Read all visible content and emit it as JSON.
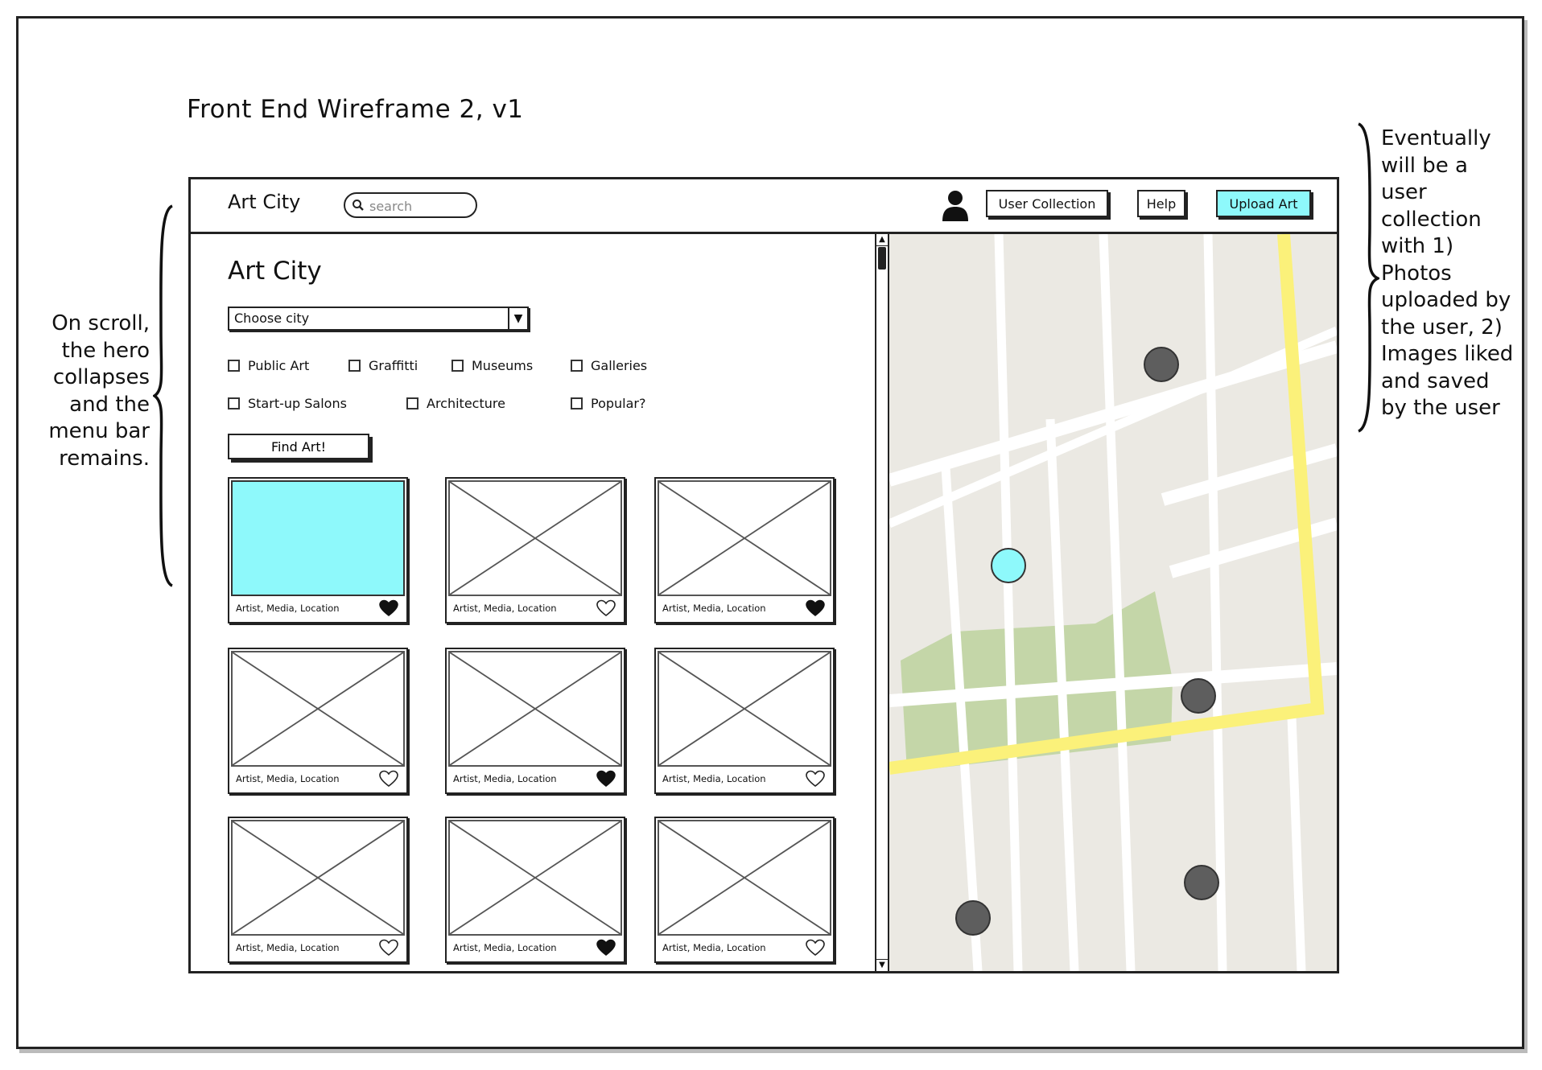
{
  "wireframe_title": "Front End Wireframe 2, v1",
  "notes": {
    "left": "On scroll,\nthe hero\ncollapses\nand the\nmenu bar\nremains.",
    "right": "Eventually\nwill be a\nuser\ncollection\nwith 1)\nPhotos\nuploaded by\nthe user, 2)\nImages liked\nand saved\nby the user"
  },
  "navbar": {
    "brand": "Art City",
    "search_placeholder": "search",
    "buttons": {
      "user_collection": "User Collection",
      "help": "Help",
      "upload_art": "Upload Art"
    }
  },
  "hero": {
    "title": "Art City",
    "city_select_value": "Choose city",
    "filters": [
      "Public Art",
      "Graffitti",
      "Museums",
      "Galleries",
      "Start-up Salons",
      "Architecture",
      "Popular?"
    ],
    "find_button": "Find Art!"
  },
  "cards": [
    {
      "caption": "Artist, Media, Location",
      "liked": true,
      "placeholder": "highlighted"
    },
    {
      "caption": "Artist, Media, Location",
      "liked": false,
      "placeholder": "image"
    },
    {
      "caption": "Artist, Media, Location",
      "liked": true,
      "placeholder": "image"
    },
    {
      "caption": "Artist, Media, Location",
      "liked": false,
      "placeholder": "image"
    },
    {
      "caption": "Artist, Media, Location",
      "liked": true,
      "placeholder": "image"
    },
    {
      "caption": "Artist, Media, Location",
      "liked": false,
      "placeholder": "image"
    },
    {
      "caption": "Artist, Media, Location",
      "liked": false,
      "placeholder": "image"
    },
    {
      "caption": "Artist, Media, Location",
      "liked": true,
      "placeholder": "image"
    },
    {
      "caption": "Artist, Media, Location",
      "liked": false,
      "placeholder": "image"
    }
  ],
  "colors": {
    "accent": "#8ef9fb",
    "map_background": "#ebe9e3",
    "map_road": "#ffffff",
    "map_highway": "#fbf17a",
    "map_park": "#c4d6a8",
    "marker": "#5e5e5e",
    "marker_selected": "#8ef9fb"
  },
  "icons": {
    "search": "search-icon",
    "user": "user-icon",
    "heart_filled": "heart-filled-icon",
    "heart_outline": "heart-outline-icon",
    "dropdown": "chevron-down-icon"
  }
}
